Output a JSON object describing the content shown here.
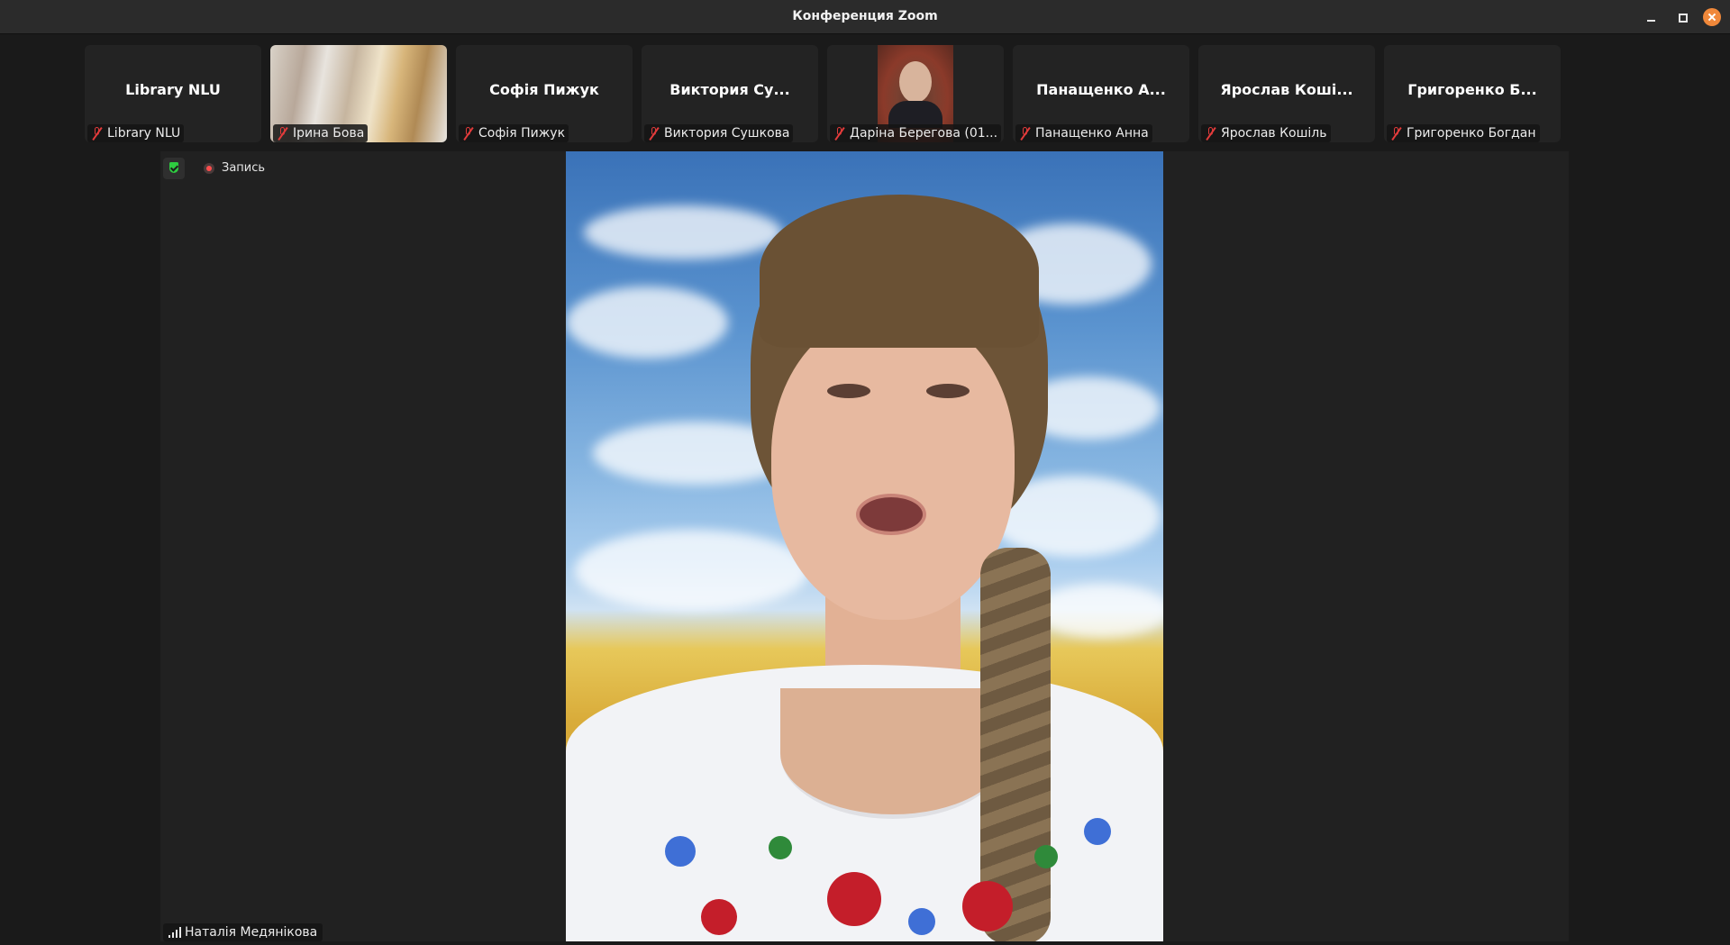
{
  "window": {
    "title": "Конференция Zoom",
    "controls": {
      "minimize": "minimize-icon",
      "maximize": "maximize-icon",
      "close": "close-icon",
      "close_color": "#f0883a"
    }
  },
  "participants": [
    {
      "big_name": "Library NLU",
      "label": "Library NLU",
      "video": false,
      "muted": true
    },
    {
      "big_name": "",
      "label": "Ірина Бова",
      "video": true,
      "muted": true
    },
    {
      "big_name": "Софія Пижук",
      "label": "Софія Пижук",
      "video": false,
      "muted": true
    },
    {
      "big_name": "Виктория Су...",
      "label": "Виктория Сушкова",
      "video": false,
      "muted": true
    },
    {
      "big_name": "",
      "label": "Дарiна Берегова (01...",
      "video": true,
      "muted": true
    },
    {
      "big_name": "Панащенко А...",
      "label": "Панащенко Анна",
      "video": false,
      "muted": true
    },
    {
      "big_name": "Ярослав Коші...",
      "label": "Ярослав Кошіль",
      "video": false,
      "muted": true
    },
    {
      "big_name": "Григоренко Б...",
      "label": "Григоренко Богдан",
      "video": false,
      "muted": true
    }
  ],
  "stage": {
    "secure_icon": "shield-check-icon",
    "secure_color": "#2ecc40",
    "recording_label": "Запись",
    "recording_color": "#ff4d4d",
    "speaker_name": "Наталія Медянікова",
    "signal_icon": "signal-bars-icon"
  }
}
